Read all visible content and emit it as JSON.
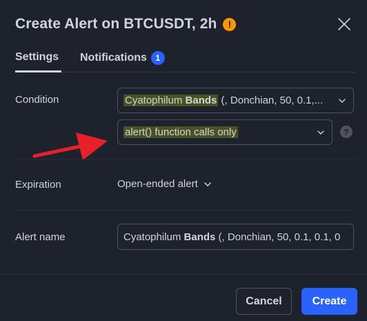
{
  "dialog": {
    "title": "Create Alert on BTCUSDT, 2h",
    "warning_icon": "!"
  },
  "tabs": [
    {
      "label": "Settings",
      "active": true
    },
    {
      "label": "Notifications",
      "badge": "1"
    }
  ],
  "condition": {
    "label": "Condition",
    "indicator_prefix": "Cyatophilum",
    "indicator_bold": "Bands",
    "indicator_suffix": " (, Donchian, 50, 0.1,...",
    "trigger": "alert() function calls only",
    "help_icon": "?"
  },
  "expiration": {
    "label": "Expiration",
    "value": "Open-ended alert"
  },
  "alert_name": {
    "label": "Alert name",
    "prefix": "Cyatophilum ",
    "bold": "Bands",
    "suffix": " (, Donchian, 50, 0.1, 0.1, 0"
  },
  "footer": {
    "cancel_label": "Cancel",
    "create_label": "Create"
  },
  "colors": {
    "background": "#1e222d",
    "accent": "#2962ff",
    "warning": "#ff9800",
    "highlight": "#4a5222",
    "annotation_arrow": "#e8202a"
  }
}
